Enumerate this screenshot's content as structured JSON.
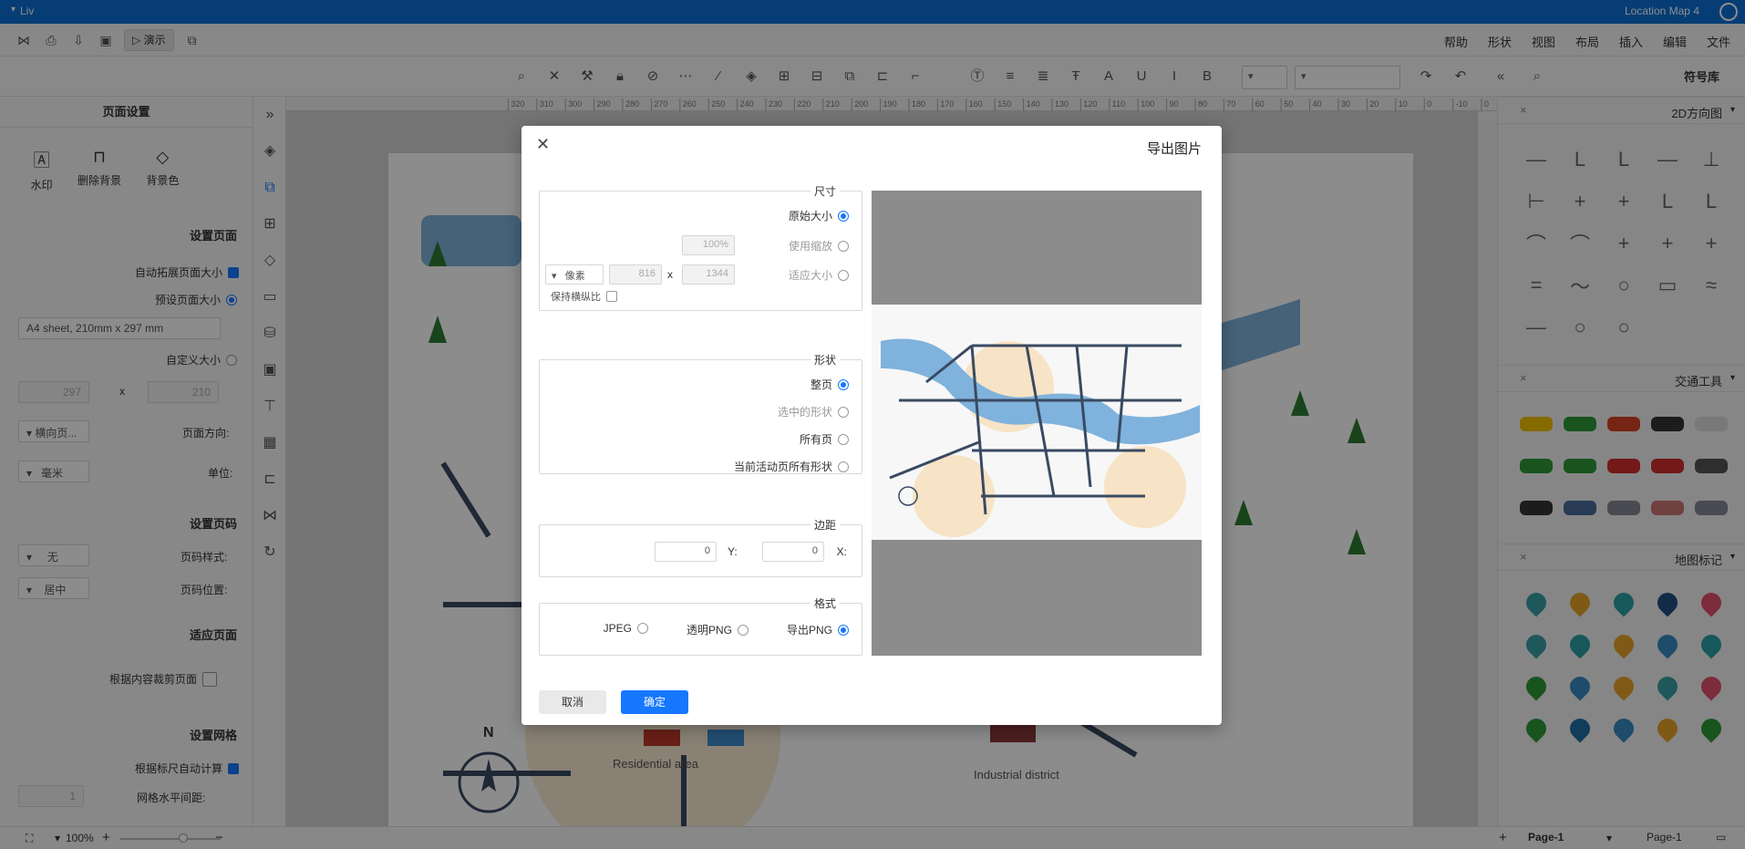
{
  "titlebar": {
    "title": "Location Map 4",
    "user": "Liv"
  },
  "menu": [
    "文件",
    "编辑",
    "插入",
    "布局",
    "视图",
    "形状",
    "帮助"
  ],
  "quick": {
    "present": "演示"
  },
  "toolbar": {
    "library": "符号库"
  },
  "left_panel": {
    "header": "页面设置",
    "buttons": [
      "背景色",
      "删除背景",
      "水印"
    ],
    "page_section": "设置页面",
    "auto_expand": "自动拓展页面大小",
    "preset_size": "预设页面大小",
    "preset_value": "A4 sheet, 210mm x 297 mm",
    "custom_size": "自定义大小",
    "width": "210",
    "height": "297",
    "x": "x",
    "orientation_label": "页面方向:",
    "orientation_value": "横向页...",
    "unit_label": "单位:",
    "unit_value": "毫米",
    "pagenum_section": "设置页码",
    "pagenum_style_label": "页码样式:",
    "pagenum_style_value": "无",
    "pagenum_pos_label": "页码位置:",
    "pagenum_pos_value": "居中",
    "fit_section": "适应页面",
    "fit_content": "根据内容裁剪页面",
    "grid_section": "设置网格",
    "grid_auto": "根据标尺自动计算",
    "grid_spacing_label": "网格水平间距:",
    "grid_spacing_value": "1"
  },
  "ruler": [
    "0",
    "-10",
    "0",
    "10",
    "20",
    "30",
    "40",
    "50",
    "60",
    "70",
    "80",
    "90",
    "100",
    "110",
    "120",
    "130",
    "140",
    "150",
    "160",
    "170",
    "180",
    "190",
    "200",
    "210",
    "220",
    "230",
    "240",
    "250",
    "260",
    "270",
    "280",
    "290",
    "300",
    "310",
    "320"
  ],
  "canvas": {
    "residential": "Residential area",
    "industrial": "Industrial district",
    "north": "N"
  },
  "right_panel": {
    "sections": [
      "2D方向图",
      "交通工具",
      "地图标记"
    ]
  },
  "statusbar": {
    "page_tab": "Page-1",
    "page_label": "Page-1",
    "zoom": "100%"
  },
  "dialog": {
    "title": "导出图片",
    "size_legend": "尺寸",
    "size_options": [
      "原始大小",
      "使用缩放",
      "适应大小"
    ],
    "scale_value": "100%",
    "fit_width": "1344",
    "fit_height": "816",
    "unit": "像素",
    "x": "x",
    "keep_ratio": "保持横纵比",
    "shape_legend": "形状",
    "shape_options": [
      "整页",
      "选中的形状",
      "所有页",
      "当前活动页所有形状"
    ],
    "margin_legend": "边距",
    "margin_x_label": "X:",
    "margin_x": "0",
    "margin_y_label": "Y:",
    "margin_y": "0",
    "format_legend": "格式",
    "format_options": [
      "导出PNG",
      "透明PNG",
      "JPEG"
    ],
    "ok": "确定",
    "cancel": "取消"
  },
  "colors": {
    "accent": "#1677ff",
    "titlebar": "#0a6fd4",
    "river": "#7fb2dc",
    "zone": "#f6ddb8",
    "road": "#3a4a62"
  }
}
